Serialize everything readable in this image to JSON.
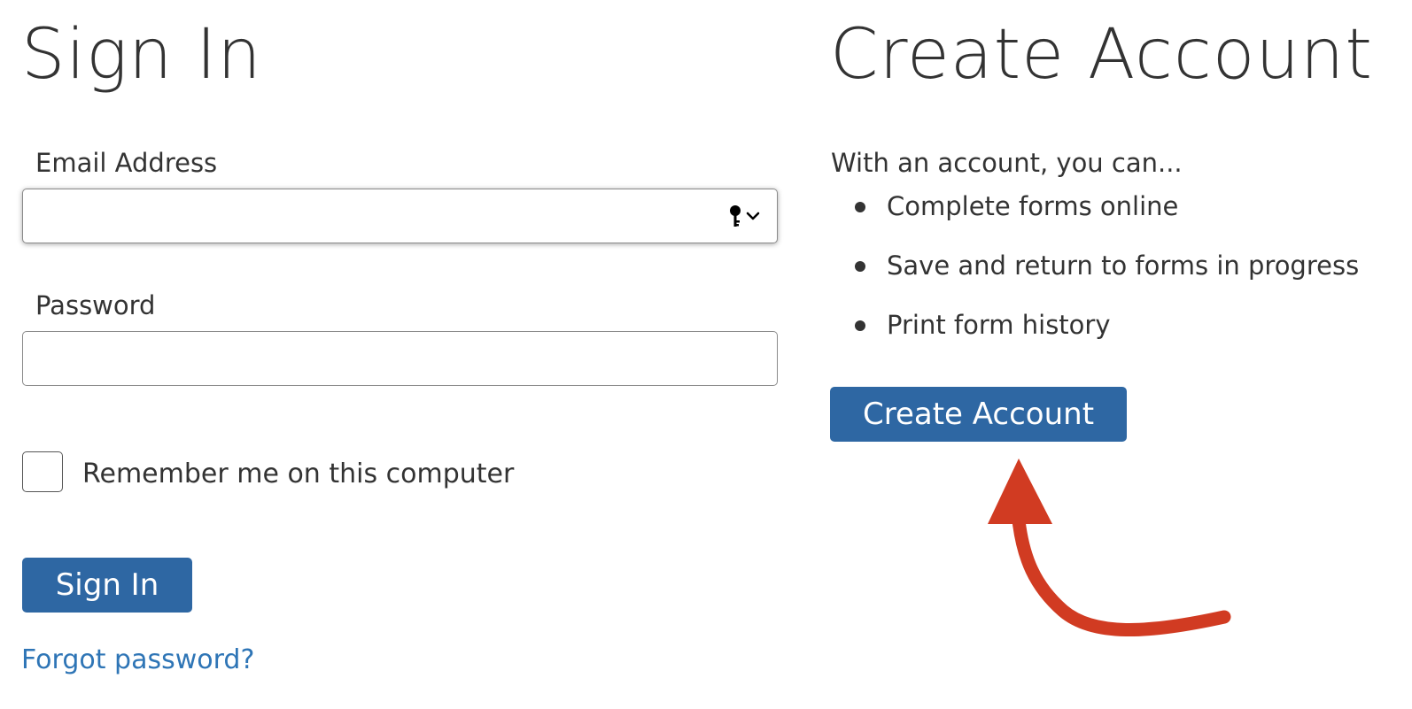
{
  "signin": {
    "title": "Sign In",
    "email_label": "Email Address",
    "email_value": "",
    "password_label": "Password",
    "password_value": "",
    "autofill_icon": "key-dropdown-icon",
    "remember_label": "Remember me on this computer",
    "remember_checked": false,
    "button_label": "Sign In",
    "forgot_link": "Forgot password?"
  },
  "create": {
    "title": "Create Account",
    "intro": "With an account, you can...",
    "benefits": [
      "Complete forms online",
      "Save and return to forms in progress",
      "Print form history"
    ],
    "button_label": "Create Account"
  },
  "annotation": {
    "icon": "curved-arrow-icon",
    "color": "#d13b22"
  },
  "colors": {
    "button_bg": "#2e67a3",
    "link": "#2e75b6",
    "text": "#333333"
  }
}
